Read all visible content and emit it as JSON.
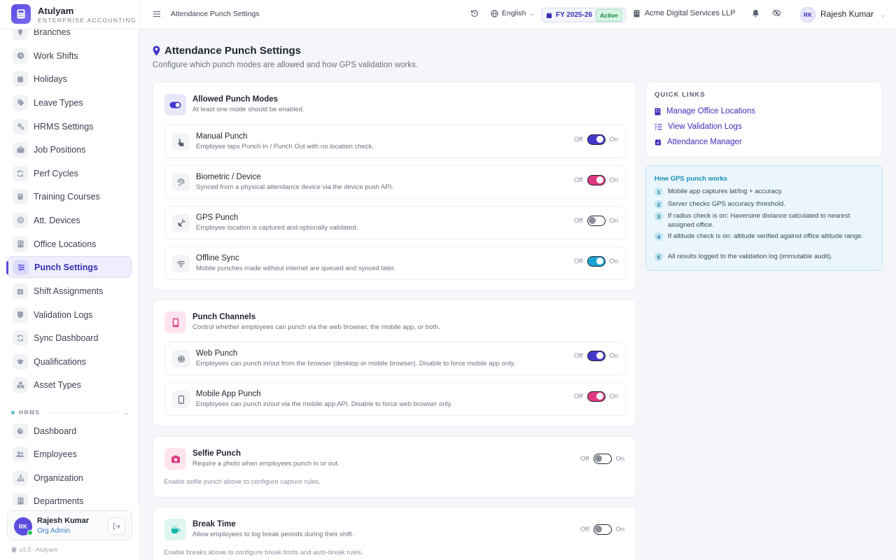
{
  "brand": {
    "name": "Atulyam",
    "subtitle": "ENTERPRISE ACCOUNTING"
  },
  "sidebar": {
    "items": [
      {
        "label": "Branches",
        "icon": "pin-icon"
      },
      {
        "label": "Work Shifts",
        "icon": "clock-icon"
      },
      {
        "label": "Holidays",
        "icon": "calendar-icon"
      },
      {
        "label": "Leave Types",
        "icon": "tag-icon"
      },
      {
        "label": "HRMS Settings",
        "icon": "cogs-icon"
      },
      {
        "label": "Job Positions",
        "icon": "briefcase-icon"
      },
      {
        "label": "Perf Cycles",
        "icon": "sync-icon"
      },
      {
        "label": "Training Courses",
        "icon": "book-icon"
      },
      {
        "label": "Att. Devices",
        "icon": "fingerprint-icon"
      },
      {
        "label": "Office Locations",
        "icon": "building-icon"
      },
      {
        "label": "Punch Settings",
        "icon": "sliders-icon"
      },
      {
        "label": "Shift Assignments",
        "icon": "calendar-check-icon"
      },
      {
        "label": "Validation Logs",
        "icon": "shield-icon"
      },
      {
        "label": "Sync Dashboard",
        "icon": "sync-icon"
      },
      {
        "label": "Qualifications",
        "icon": "graduation-cap-icon"
      },
      {
        "label": "Asset Types",
        "icon": "boxes-icon"
      }
    ],
    "section_label": "HRMS",
    "hrms_items": [
      {
        "label": "Dashboard",
        "icon": "pie-chart-icon"
      },
      {
        "label": "Employees",
        "icon": "users-icon"
      },
      {
        "label": "Organization",
        "icon": "sitemap-icon"
      },
      {
        "label": "Departments",
        "icon": "building-icon"
      }
    ],
    "user": {
      "initials": "RK",
      "name": "Rajesh Kumar",
      "role": "Org Admin"
    },
    "version": "v1.0 · Atulyam"
  },
  "topbar": {
    "breadcrumb": "Attendance Punch Settings",
    "language": "English",
    "fy": "FY 2025-26",
    "fy_status": "Active",
    "company": "Acme Digital Services LLP",
    "user_initials": "RK",
    "user_name": "Rajesh Kumar"
  },
  "page": {
    "title": "Attendance Punch Settings",
    "subtitle": "Configure which punch modes are allowed and how GPS validation works."
  },
  "labels": {
    "off": "Off",
    "on": "On"
  },
  "modes": {
    "title": "Allowed Punch Modes",
    "subtitle": "At least one mode should be enabled.",
    "rows": [
      {
        "title": "Manual Punch",
        "sub": "Employee taps Punch In / Punch Out with no location check.",
        "enabled": true
      },
      {
        "title": "Biometric / Device",
        "sub": "Synced from a physical attendance device via the device push API.",
        "enabled": true
      },
      {
        "title": "GPS Punch",
        "sub": "Employee location is captured and optionally validated.",
        "enabled": false
      },
      {
        "title": "Offline Sync",
        "sub": "Mobile punches made without internet are queued and synced later.",
        "enabled": true
      }
    ]
  },
  "channels": {
    "title": "Punch Channels",
    "subtitle": "Control whether employees can punch via the web browser, the mobile app, or both.",
    "rows": [
      {
        "title": "Web Punch",
        "sub": "Employees can punch in/out from the browser (desktop or mobile browser). Disable to force mobile app only.",
        "enabled": true
      },
      {
        "title": "Mobile App Punch",
        "sub": "Employees can punch in/out via the mobile app API. Disable to force web browser only.",
        "enabled": true
      }
    ]
  },
  "selfie": {
    "title": "Selfie Punch",
    "subtitle": "Require a photo when employees punch in or out.",
    "note": "Enable selfie punch above to configure capture rules.",
    "enabled": false
  },
  "break_time": {
    "title": "Break Time",
    "subtitle": "Allow employees to log break periods during their shift.",
    "note": "Enable breaks above to configure break limits and auto-break rules.",
    "enabled": false
  },
  "quick_links": {
    "title": "QUICK LINKS",
    "items": [
      {
        "label": "Manage Office Locations",
        "icon": "building-icon"
      },
      {
        "label": "View Validation Logs",
        "icon": "list-check-icon"
      },
      {
        "label": "Attendance Manager",
        "icon": "calendar-check-icon"
      }
    ]
  },
  "gps_info": {
    "title": "How GPS punch works",
    "steps": [
      {
        "num": "1",
        "text": "Mobile app captures lat/lng + accuracy."
      },
      {
        "num": "2",
        "text": "Server checks GPS accuracy threshold."
      },
      {
        "num": "3",
        "text": "If radius check is on: Haversine distance calculated to nearest assigned office."
      },
      {
        "num": "4",
        "text": "If altitude check is on: altitude verified against office altitude range."
      },
      {
        "num": "5",
        "text": "All results logged to the validation log (immutable audit)."
      }
    ]
  }
}
